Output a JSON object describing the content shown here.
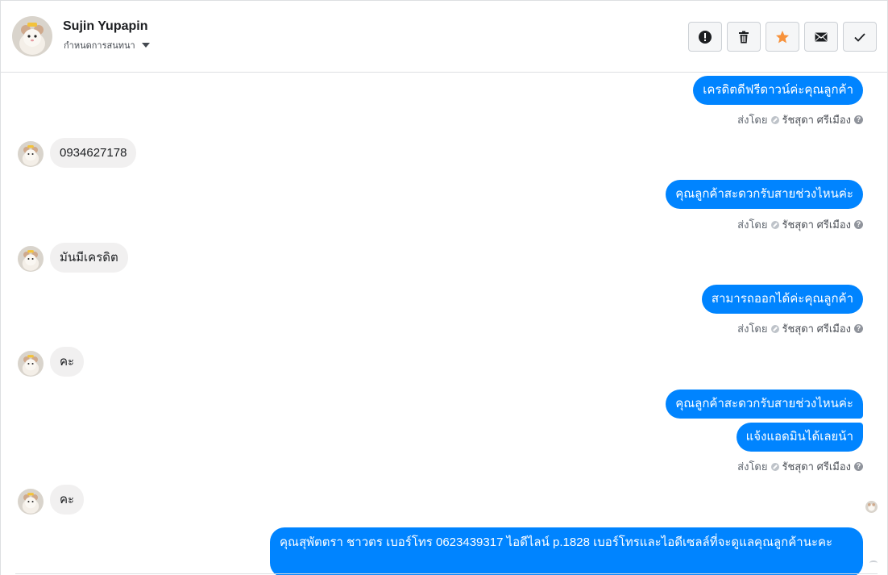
{
  "header": {
    "contact_name": "Sujin Yupapin",
    "conversation_settings": "กำหนดการสนทนา",
    "avatar_icon": "hamster-avatar-icon"
  },
  "toolbar": {
    "buttons": [
      {
        "name": "spam-button",
        "icon": "exclamation-circle-icon"
      },
      {
        "name": "delete-button",
        "icon": "trash-icon"
      },
      {
        "name": "star-button",
        "icon": "star-icon",
        "color": "#f7923b"
      },
      {
        "name": "mark-unread-button",
        "icon": "envelope-icon"
      },
      {
        "name": "mark-done-button",
        "icon": "checkmark-icon"
      }
    ]
  },
  "sent_by_label": "ส่งโดย",
  "sender_name": "รัชสุดา ศรีเมือง",
  "colors": {
    "outgoing_bubble": "#0084ff",
    "incoming_bubble": "#f1f0f0",
    "star": "#f7923b"
  },
  "messages": [
    {
      "direction": "out",
      "text": "เครดิตดีฟรีดาวน์ค่ะคุณลูกค้า"
    },
    {
      "direction": "in",
      "text": "0934627178"
    },
    {
      "direction": "out",
      "text": "คุณลูกค้าสะดวกรับสายช่วงไหนค่ะ"
    },
    {
      "direction": "in",
      "text": "มันมีเครดิต"
    },
    {
      "direction": "out",
      "text": "สามารถออกได้ค่ะคุณลูกค้า"
    },
    {
      "direction": "in",
      "text": "คะ"
    },
    {
      "direction": "out",
      "text": "คุณลูกค้าสะดวกรับสายช่วงไหนค่ะ"
    },
    {
      "direction": "out",
      "text": "แจ้งแอดมินได้เลยน้า"
    },
    {
      "direction": "in",
      "text": "คะ"
    },
    {
      "direction": "out",
      "text": "คุณสุพัตตรา   ชาวตร     เบอร์โทร 0623439317  ไอดีไลน์ p.1828   เบอร์โทรและไอดีเซลล์ที่จะดูแลคุณลูกค้านะคะ"
    }
  ]
}
